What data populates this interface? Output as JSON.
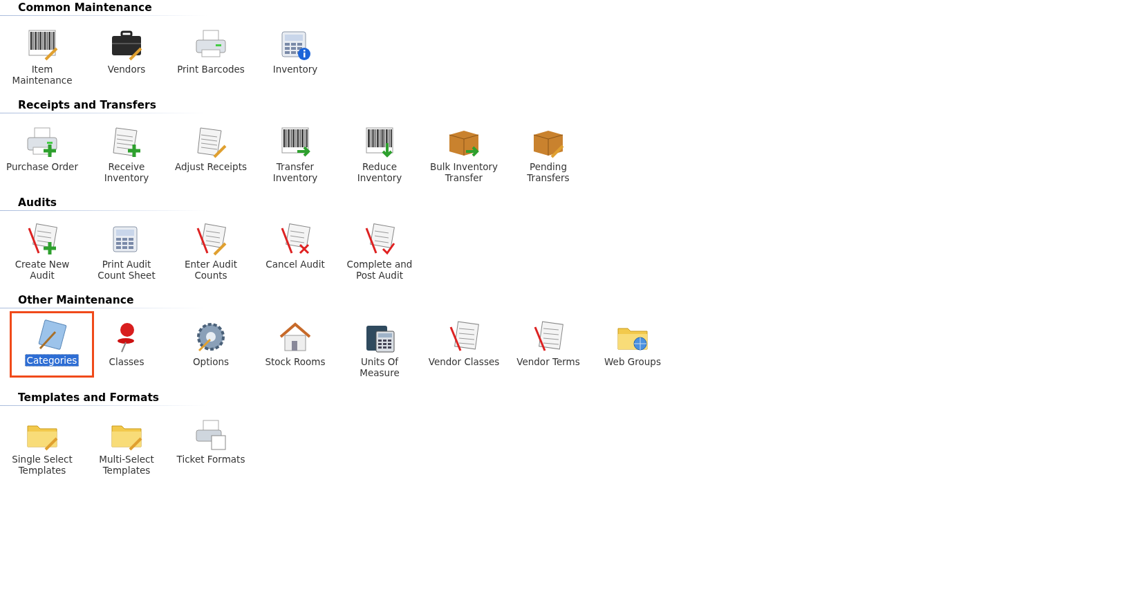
{
  "sections": [
    {
      "title": "Common Maintenance",
      "items": [
        {
          "label": "Item Maintenance",
          "selected": false
        },
        {
          "label": "Vendors",
          "selected": false
        },
        {
          "label": "Print Barcodes",
          "selected": false
        },
        {
          "label": "Inventory",
          "selected": false
        }
      ]
    },
    {
      "title": "Receipts and Transfers",
      "items": [
        {
          "label": "Purchase Order",
          "selected": false
        },
        {
          "label": "Receive Inventory",
          "selected": false
        },
        {
          "label": "Adjust Receipts",
          "selected": false
        },
        {
          "label": "Transfer Inventory",
          "selected": false
        },
        {
          "label": "Reduce Inventory",
          "selected": false
        },
        {
          "label": "Bulk Inventory Transfer",
          "selected": false
        },
        {
          "label": "Pending Transfers",
          "selected": false
        }
      ]
    },
    {
      "title": "Audits",
      "items": [
        {
          "label": "Create New Audit",
          "selected": false
        },
        {
          "label": "Print Audit Count Sheet",
          "selected": false
        },
        {
          "label": "Enter Audit Counts",
          "selected": false
        },
        {
          "label": "Cancel Audit",
          "selected": false
        },
        {
          "label": "Complete and Post Audit",
          "selected": false
        }
      ]
    },
    {
      "title": "Other Maintenance",
      "items": [
        {
          "label": "Categories",
          "selected": true
        },
        {
          "label": "Classes",
          "selected": false
        },
        {
          "label": "Options",
          "selected": false
        },
        {
          "label": "Stock Rooms",
          "selected": false
        },
        {
          "label": "Units Of Measure",
          "selected": false
        },
        {
          "label": "Vendor Classes",
          "selected": false
        },
        {
          "label": "Vendor Terms",
          "selected": false
        },
        {
          "label": "Web Groups",
          "selected": false
        }
      ]
    },
    {
      "title": "Templates and Formats",
      "items": [
        {
          "label": "Single Select Templates",
          "selected": false
        },
        {
          "label": "Multi-Select Templates",
          "selected": false
        },
        {
          "label": "Ticket Formats",
          "selected": false
        }
      ]
    }
  ]
}
